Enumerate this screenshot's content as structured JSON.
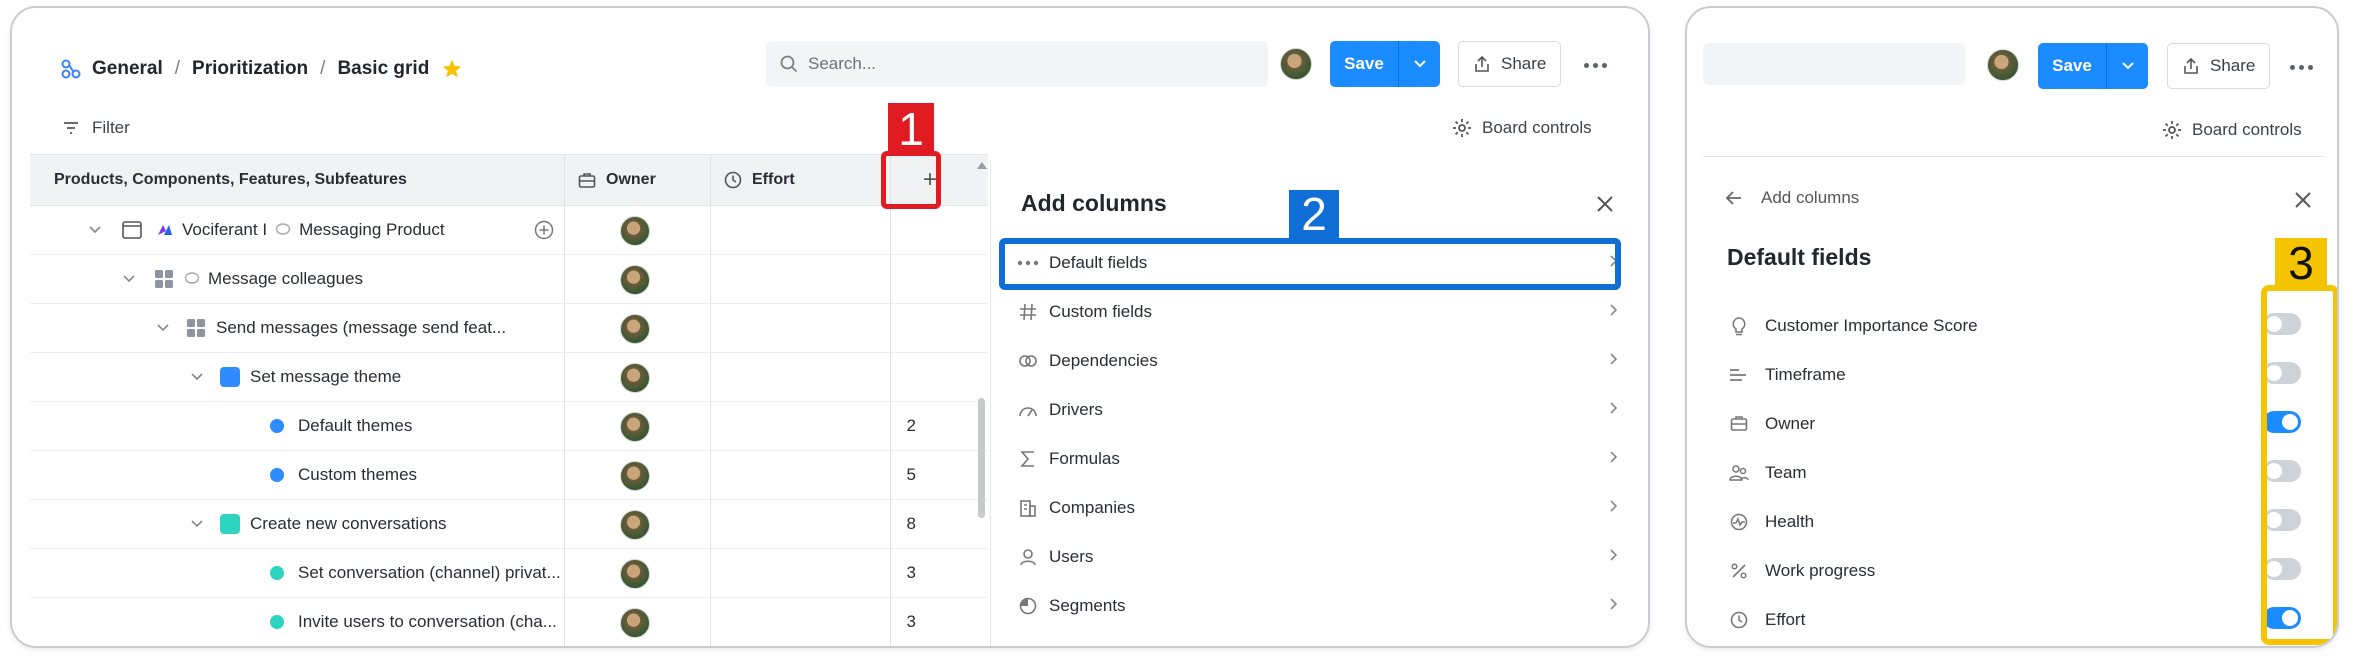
{
  "colors": {
    "accent": "#1a8cff",
    "marker1": "#e11b22",
    "marker2": "#0f6fd6",
    "marker3": "#f5c400"
  },
  "breadcrumb": {
    "items": [
      "General",
      "Prioritization",
      "Basic grid"
    ],
    "separator": "/"
  },
  "search": {
    "placeholder": "Search..."
  },
  "toolbar": {
    "save_label": "Save",
    "share_label": "Share",
    "filter_label": "Filter",
    "board_controls_label": "Board controls"
  },
  "grid": {
    "headers": {
      "name": "Products, Components, Features, Subfeatures",
      "owner": "Owner",
      "effort": "Effort",
      "add": "+"
    },
    "rows": [
      {
        "name": "Vociferant I",
        "suffix": "Messaging Product",
        "effort": ""
      },
      {
        "name": "Message colleagues",
        "effort": ""
      },
      {
        "name": "Send messages (message send feat...",
        "effort": ""
      },
      {
        "name": "Set message theme",
        "effort": ""
      },
      {
        "name": "Default themes",
        "effort": "2"
      },
      {
        "name": "Custom themes",
        "effort": "5"
      },
      {
        "name": "Create new conversations",
        "effort": "8"
      },
      {
        "name": "Set conversation (channel) privat...",
        "effort": "3"
      },
      {
        "name": "Invite users to conversation (cha...",
        "effort": "3"
      }
    ]
  },
  "add_columns": {
    "title": "Add columns",
    "items": [
      "Default fields",
      "Custom fields",
      "Dependencies",
      "Drivers",
      "Formulas",
      "Companies",
      "Users",
      "Segments"
    ]
  },
  "default_fields": {
    "back_label": "Add columns",
    "title": "Default fields",
    "fields": [
      {
        "label": "Customer Importance Score",
        "enabled": false
      },
      {
        "label": "Timeframe",
        "enabled": false
      },
      {
        "label": "Owner",
        "enabled": true
      },
      {
        "label": "Team",
        "enabled": false
      },
      {
        "label": "Health",
        "enabled": false
      },
      {
        "label": "Work progress",
        "enabled": false
      },
      {
        "label": "Effort",
        "enabled": true
      }
    ]
  },
  "markers": {
    "one": "1",
    "two": "2",
    "three": "3"
  }
}
